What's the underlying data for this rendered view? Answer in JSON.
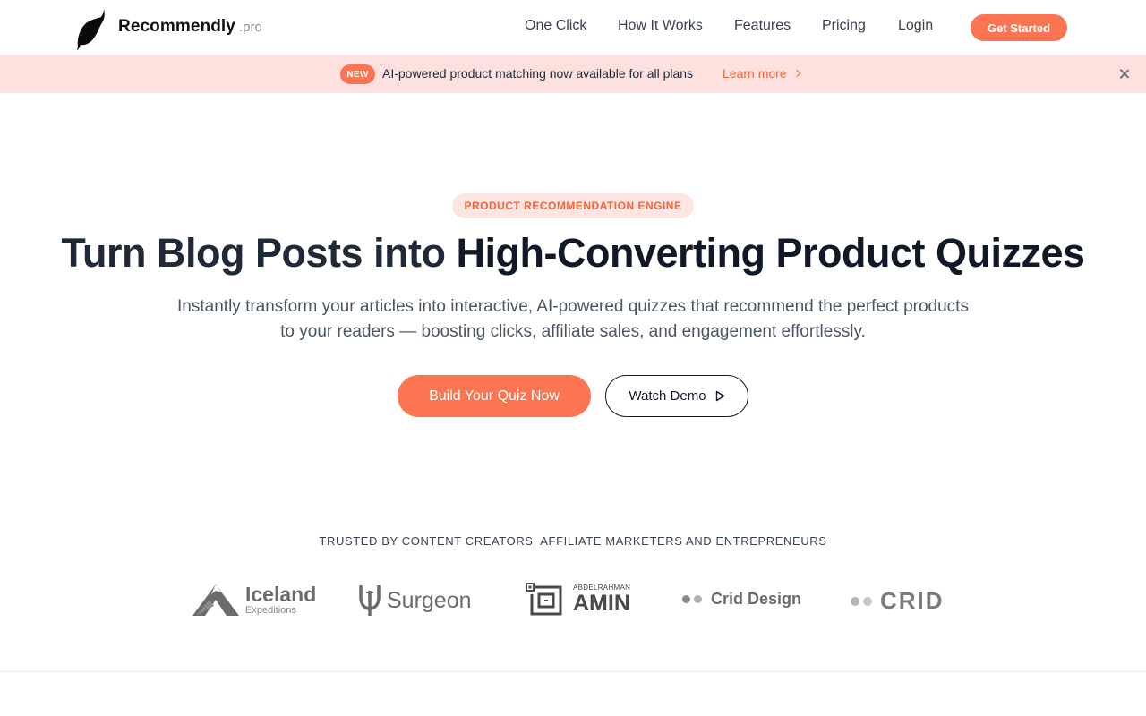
{
  "brand": {
    "name": "Recommendly",
    "tld": ".pro"
  },
  "nav": {
    "links": [
      "One Click",
      "How It Works",
      "Features",
      "Pricing",
      "Login"
    ],
    "cta": "Get Started"
  },
  "announcement": {
    "badge": "NEW",
    "text": "AI-powered product matching now available for all plans",
    "link": "Learn more"
  },
  "hero": {
    "pill": "PRODUCT RECOMMENDATION ENGINE",
    "headline_regular": "Turn Blog Posts into ",
    "headline_bold": "High-Converting Product Quizzes",
    "subheadline": "Instantly transform your articles into interactive, AI-powered quizzes that recommend the perfect products to your readers — boosting clicks, affiliate sales, and engagement effortlessly.",
    "primary_button": "Build Your Quiz Now",
    "secondary_button": "Watch Demo"
  },
  "trusted": {
    "heading": "TRUSTED BY CONTENT CREATORS, AFFILIATE MARKETERS AND ENTREPRENEURS",
    "logos": [
      {
        "name": "Iceland",
        "sub": "Expeditions"
      },
      {
        "name": "Surgeon"
      },
      {
        "name": "AMIN",
        "sub": "ABDELRAHMAN"
      },
      {
        "name": "Crid Design"
      },
      {
        "name": "CRID"
      }
    ]
  },
  "colors": {
    "accent": "#fb7552",
    "banner_bg": "#fde1de",
    "text_dark": "#111827"
  }
}
